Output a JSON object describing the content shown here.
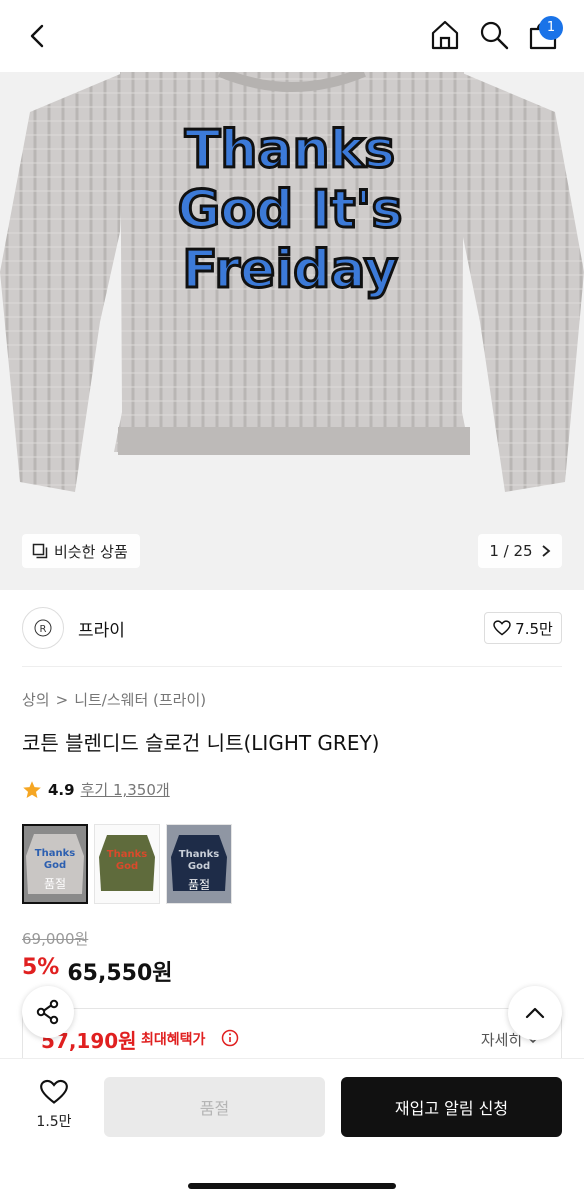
{
  "header": {
    "cart_count": "1"
  },
  "hero": {
    "similar_label": "비슷한 상품",
    "pager": "1 / 25"
  },
  "brand": {
    "name": "프라이",
    "like_count": "7.5만"
  },
  "breadcrumb": {
    "level1": "상의",
    "separator": ">",
    "level2": "니트/스웨터 (프라이)"
  },
  "product": {
    "title": "코튼 블렌디드 슬로건 니트(LIGHT GREY)",
    "rating": "4.9",
    "review_link": "후기 1,350개"
  },
  "swatches": [
    {
      "color": "light grey",
      "status": "품절",
      "selected": true
    },
    {
      "color": "khaki",
      "status": "",
      "selected": false
    },
    {
      "color": "navy",
      "status": "품절",
      "selected": false
    }
  ],
  "price": {
    "original": "69,000원",
    "discount": "5%",
    "sale": "65,550원"
  },
  "benefit": {
    "price": "57,190원",
    "label": "최대혜택가",
    "detail": "자세히"
  },
  "bottom": {
    "wish_count": "1.5만",
    "soldout_label": "품절",
    "restock_label": "재입고 알림 신청"
  },
  "colors": {
    "accent_red": "#e02020",
    "badge_blue": "#1a73e8",
    "cta_black": "#111111"
  },
  "icons": [
    "back-icon",
    "home-icon",
    "search-icon",
    "shopping-bag-icon",
    "similar-icon",
    "chevron-right-icon",
    "heart-icon",
    "star-icon",
    "info-icon",
    "chevron-down-icon",
    "share-icon",
    "chevron-up-icon"
  ]
}
